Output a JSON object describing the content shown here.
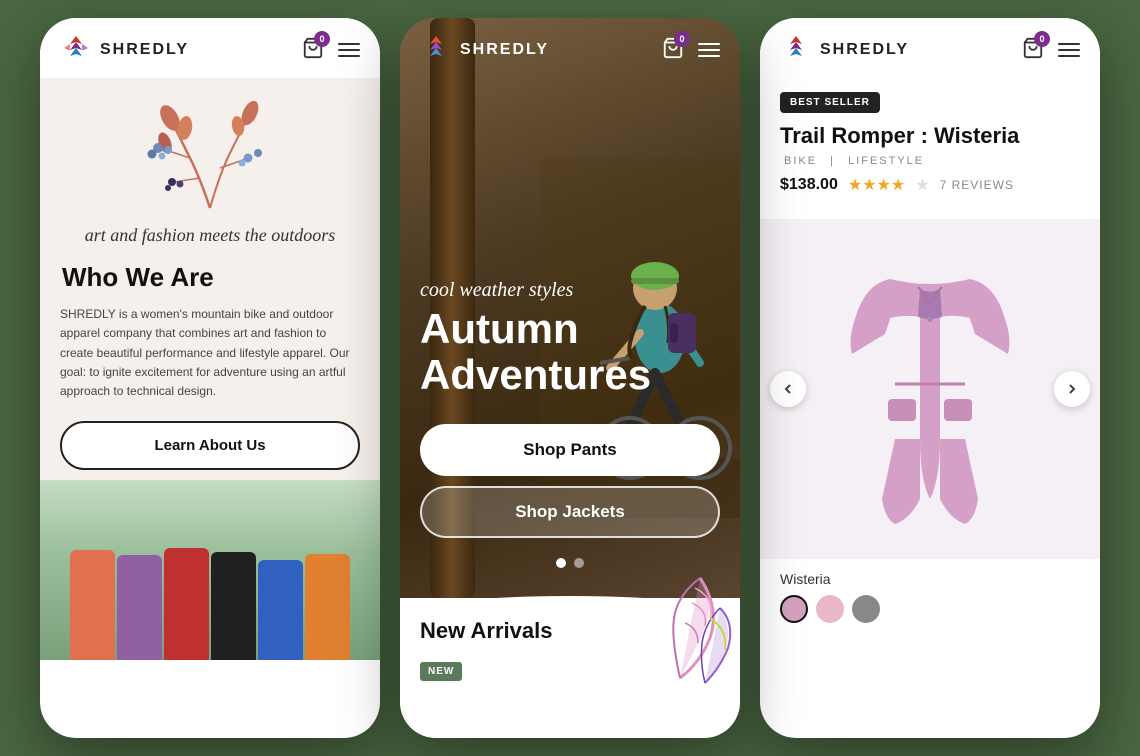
{
  "brand": {
    "name": "SHREDLY"
  },
  "phone1": {
    "nav": {
      "logo": "SHREDLY",
      "cart_count": "0"
    },
    "hero": {
      "tagline": "art and fashion meets the outdoors",
      "heading": "Who We Are",
      "description": "SHREDLY is a women's mountain bike and outdoor apparel company that combines art and fashion to create beautiful performance and lifestyle apparel. Our goal: to ignite excitement for adventure using an artful approach to technical design.",
      "cta_label": "Learn About Us"
    }
  },
  "phone2": {
    "nav": {
      "logo": "SHREDLY",
      "cart_count": "0"
    },
    "hero": {
      "cool_weather": "cool weather styles",
      "heading_line1": "Autumn",
      "heading_line2": "Adventures",
      "btn_pants": "Shop Pants",
      "btn_jackets": "Shop Jackets"
    },
    "bottom": {
      "heading": "New Arrivals",
      "badge": "NEW"
    }
  },
  "phone3": {
    "nav": {
      "logo": "SHREDLY",
      "cart_count": "0"
    },
    "product": {
      "badge": "BEST SELLER",
      "title": "Trail Romper : Wisteria",
      "cat1": "BIKE",
      "separator": "|",
      "cat2": "LIFESTYLE",
      "price": "$138.00",
      "review_count": "7 REVIEWS",
      "color_label": "Wisteria"
    }
  }
}
